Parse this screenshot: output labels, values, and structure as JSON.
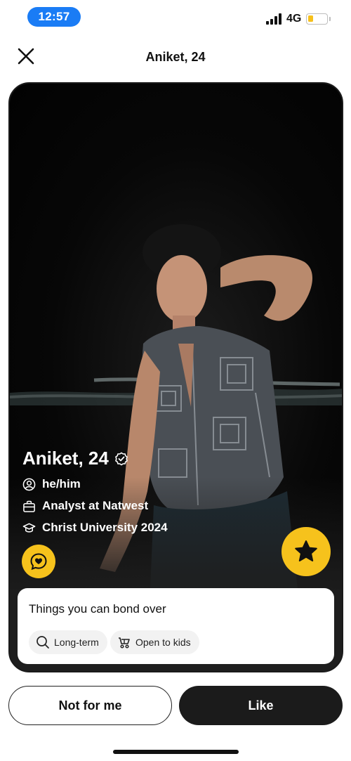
{
  "status_bar": {
    "time": "12:57",
    "network": "4G",
    "battery_level": 0.25,
    "accent_color": "#1a7cf5",
    "battery_color": "#f6c01b"
  },
  "header": {
    "title": "Aniket, 24",
    "close_icon": "close-icon"
  },
  "profile": {
    "name": "Aniket, 24",
    "verified_icon": "verified-icon",
    "pronouns": "he/him",
    "job": "Analyst at Natwest",
    "education": "Christ University 2024",
    "accent_color": "#f6c21c"
  },
  "bond": {
    "title": "Things you can bond over",
    "chips": [
      {
        "icon": "search-icon",
        "label": "Long-term"
      },
      {
        "icon": "stroller-icon",
        "label": "Open to kids"
      }
    ]
  },
  "actions": {
    "not_for_me": "Not for me",
    "like": "Like"
  }
}
